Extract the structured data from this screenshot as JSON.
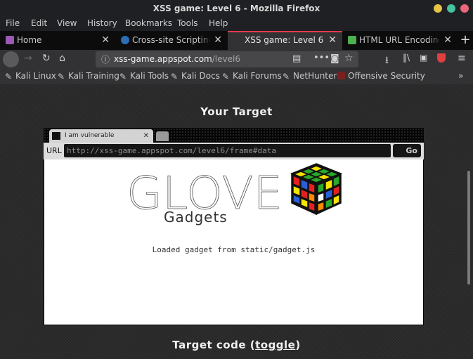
{
  "window": {
    "title": "XSS game: Level 6 - Mozilla Firefox"
  },
  "menu": [
    "File",
    "Edit",
    "View",
    "History",
    "Bookmarks",
    "Tools",
    "Help"
  ],
  "tabs": [
    {
      "label": "Home",
      "icon": "purple-page-icon",
      "color": "#9b59b6"
    },
    {
      "label": "Cross-site Scripting (X",
      "icon": "globe-icon",
      "color": "#2d6db5"
    },
    {
      "label": "XSS game: Level 6",
      "active": true
    },
    {
      "label": "HTML URL Encoding R",
      "icon": "green-code-icon",
      "color": "#4caf50"
    }
  ],
  "url": {
    "host": "xss-game.appspot.com",
    "path": "/level6"
  },
  "bookmarks": [
    "Kali Linux",
    "Kali Training",
    "Kali Tools",
    "Kali Docs",
    "Kali Forums",
    "NetHunter",
    "Offensive Security"
  ],
  "page": {
    "heading": "Your Target",
    "code_heading_prefix": "Target code (",
    "code_toggle": "toggle",
    "code_heading_suffix": ")"
  },
  "frame": {
    "tab_label": "I am vulnerable",
    "url_label": "URL",
    "url_value": "http://xss-game.appspot.com/level6/frame#data",
    "go_label": "Go",
    "brand_main": "GLOVE",
    "brand_sub": "Gadgets",
    "status": "Loaded gadget from static/gadget.js"
  }
}
